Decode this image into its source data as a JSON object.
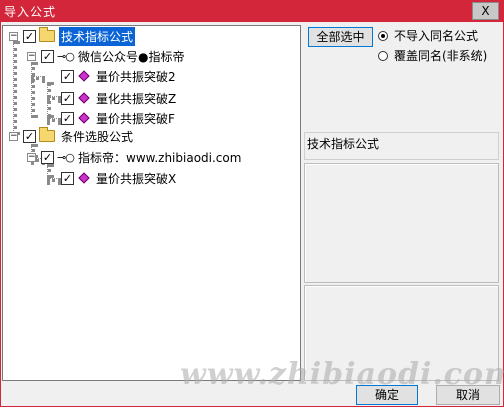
{
  "window": {
    "title": "导入公式",
    "close_label": "X"
  },
  "tree": {
    "groups": [
      {
        "label": "技术指标公式",
        "expander": "−",
        "checked": "✓",
        "subfolder": {
          "label": "微信公众号●指标帝",
          "expander": "−",
          "checked": "✓",
          "items": [
            {
              "label": "量价共振突破2",
              "checked": "✓"
            },
            {
              "label": "量化共振突破Z",
              "checked": "✓"
            },
            {
              "label": "量价共振突破F",
              "checked": "✓"
            }
          ]
        }
      },
      {
        "label": "条件选股公式",
        "expander": "−",
        "checked": "✓",
        "subfolder": {
          "label": "指标帝：www.zhibiaodi.com",
          "expander": "−",
          "checked": "✓",
          "items": [
            {
              "label": "量价共振突破X",
              "checked": "✓"
            }
          ]
        }
      }
    ]
  },
  "options": {
    "select_all_label": "全部选中",
    "radio_no_import": "不导入同名公式",
    "radio_overwrite": "覆盖同名(非系统)",
    "selected_radio": "no_import"
  },
  "detail": {
    "category_label": "技术指标公式"
  },
  "footer": {
    "ok_label": "确定",
    "cancel_label": "取消"
  },
  "watermark": {
    "text": "www.zhibiaodi.com"
  },
  "colors": {
    "titlebar": "#d4263b",
    "selection": "#0a64d8",
    "item_icon": "#cc33cc",
    "folder": "#f5d76e"
  }
}
